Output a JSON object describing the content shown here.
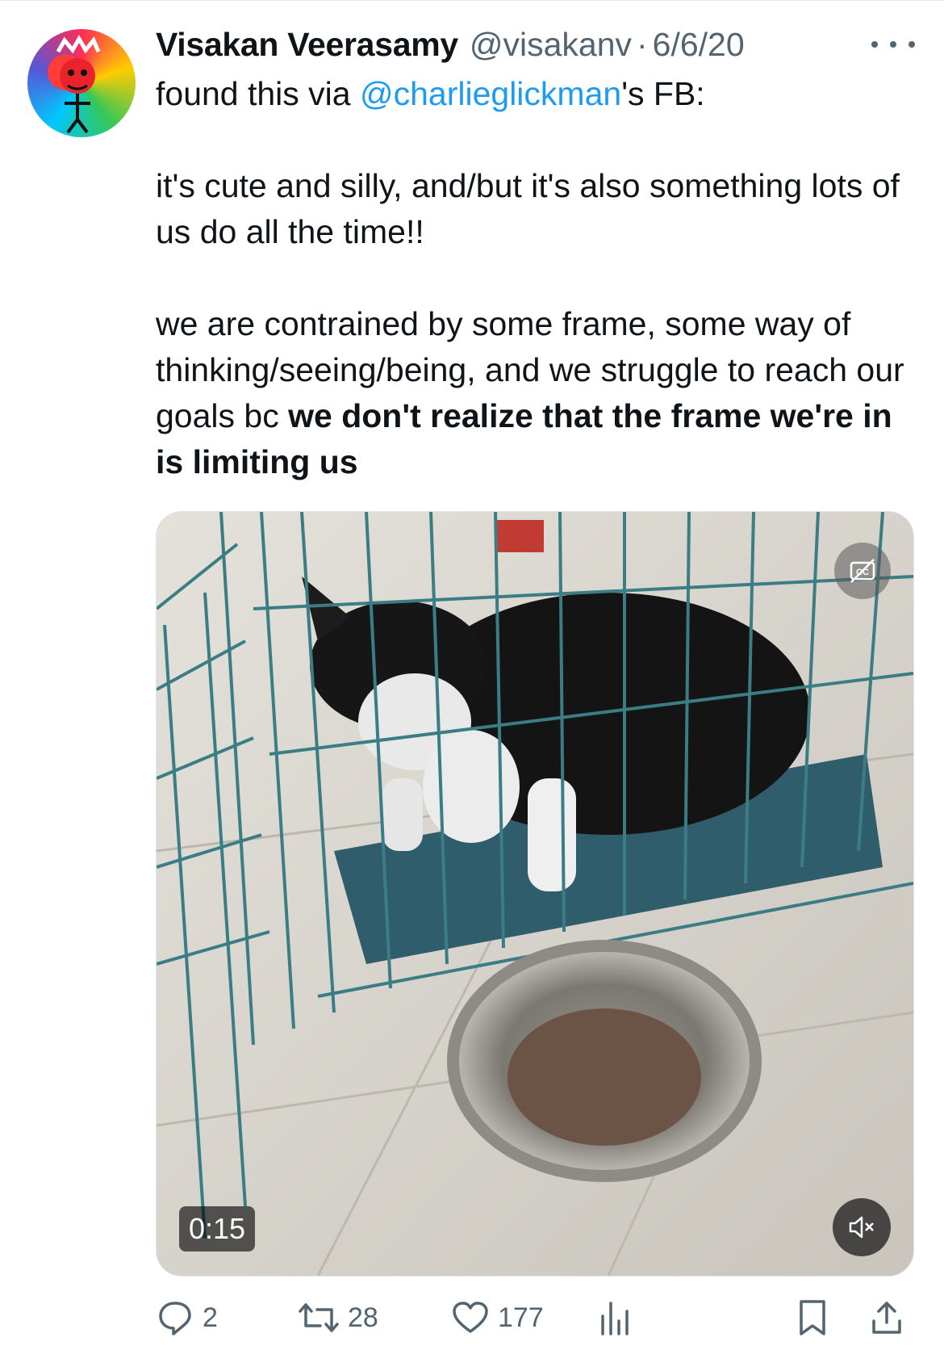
{
  "author": {
    "display_name": "Visakan Veerasamy",
    "handle": "@visakanv",
    "separator": "·",
    "date": "6/6/20"
  },
  "tweet": {
    "line1_prefix": "found this via ",
    "mention": "@charlieglickman",
    "line1_suffix": "'s FB:",
    "para2": "it's cute and silly, and/but it's also something lots of us do all the time!!",
    "para3_plain": "we are contrained by some frame, some way of thinking/seeing/being, and we struggle to reach our goals bc ",
    "para3_bold": "we don't realize that the frame we're in is limiting us"
  },
  "media": {
    "duration": "0:15",
    "cc_icon": "closed-captions-off-icon",
    "mute_icon": "speaker-muted-icon"
  },
  "actions": {
    "replies": "2",
    "reposts": "28",
    "likes": "177"
  },
  "colors": {
    "text": "#0f1419",
    "secondary": "#536471",
    "link": "#1d9bf0"
  }
}
